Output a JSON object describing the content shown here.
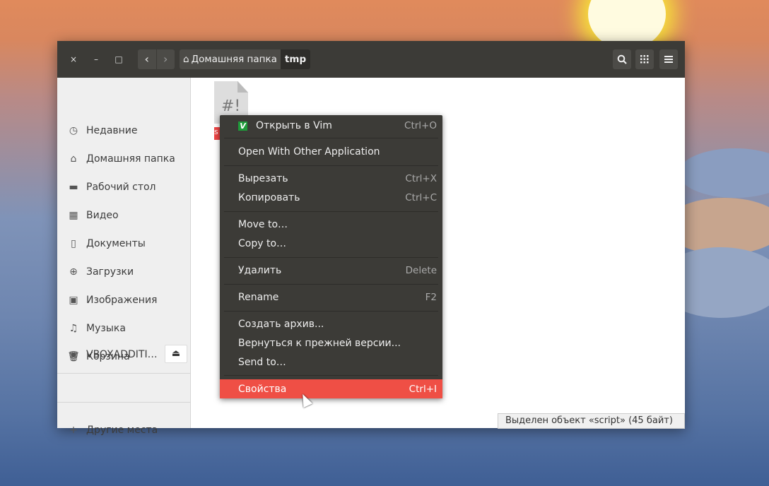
{
  "window": {
    "controls": {
      "close": "×",
      "minimize": "–",
      "maximize": "□"
    },
    "breadcrumb": [
      {
        "label": "Домашняя папка",
        "icon": "home-icon"
      },
      {
        "label": "tmp"
      }
    ],
    "toolbar": [
      "search-icon",
      "grid-view-icon",
      "hamburger-menu-icon"
    ]
  },
  "sidebar": {
    "items": [
      {
        "label": "Недавние",
        "icon": "◷"
      },
      {
        "label": "Домашняя папка",
        "icon": "⌂"
      },
      {
        "label": "Рабочий стол",
        "icon": "▬"
      },
      {
        "label": "Видео",
        "icon": "▦"
      },
      {
        "label": "Документы",
        "icon": "▯"
      },
      {
        "label": "Загрузки",
        "icon": "⊕"
      },
      {
        "label": "Изображения",
        "icon": "▣"
      },
      {
        "label": "Музыка",
        "icon": "♫"
      },
      {
        "label": "Корзина",
        "icon": "🗑"
      }
    ],
    "device": {
      "label": "VBOXADDITI…",
      "icon": "◉",
      "eject": "⏏"
    },
    "other": {
      "label": "Другие места",
      "icon": "+"
    }
  },
  "file": {
    "glyph": "#!",
    "label": "s"
  },
  "context_menu": {
    "items": [
      {
        "label": "Открыть в Vim",
        "shortcut": "Ctrl+O"
      },
      {
        "label": "Open With Other Application",
        "shortcut": ""
      },
      {
        "label": "Вырезать",
        "shortcut": "Ctrl+X"
      },
      {
        "label": "Копировать",
        "shortcut": "Ctrl+C"
      },
      {
        "label": "Move to…",
        "shortcut": ""
      },
      {
        "label": "Copy to…",
        "shortcut": ""
      },
      {
        "label": "Удалить",
        "shortcut": "Delete"
      },
      {
        "label": "Rename",
        "shortcut": "F2"
      },
      {
        "label": "Создать архив...",
        "shortcut": ""
      },
      {
        "label": "Вернуться к прежней версии...",
        "shortcut": ""
      },
      {
        "label": "Send to…",
        "shortcut": ""
      },
      {
        "label": "Свойства",
        "shortcut": "Ctrl+I"
      }
    ],
    "highlight_color": "#ef4f45"
  },
  "status": "Выделен объект «script» (45 байт)"
}
